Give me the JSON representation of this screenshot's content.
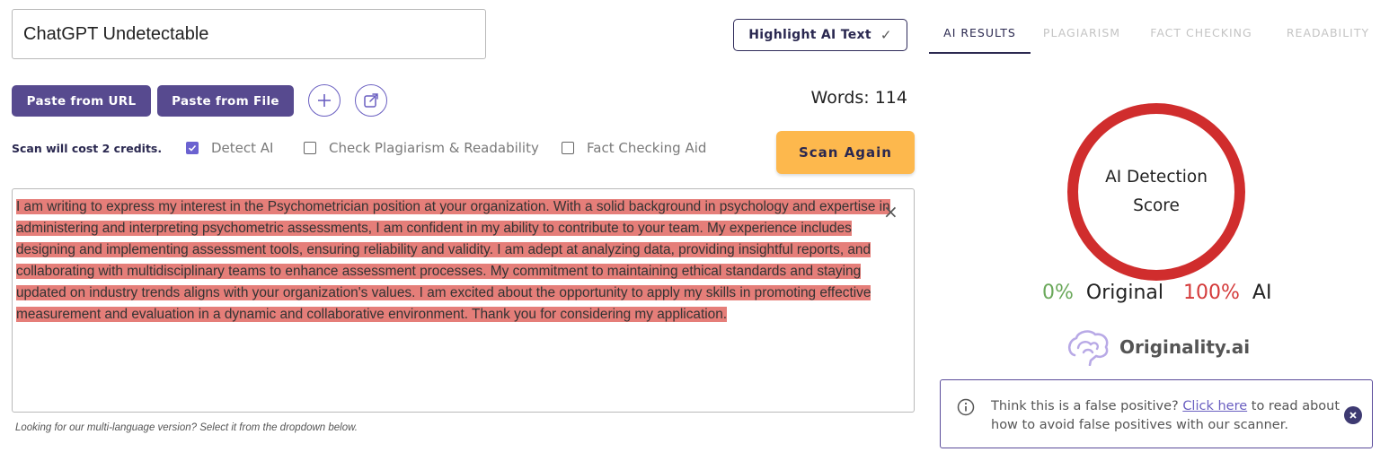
{
  "title_input": {
    "value": "ChatGPT Undetectable"
  },
  "highlight_button": {
    "label": "Highlight AI Text",
    "check": "✓"
  },
  "tabs": [
    {
      "label": "AI RESULTS",
      "active": true
    },
    {
      "label": "PLAGIARISM",
      "active": false
    },
    {
      "label": "FACT CHECKING",
      "active": false
    },
    {
      "label": "READABILITY",
      "active": false
    }
  ],
  "toolbar": {
    "paste_url": "Paste from URL",
    "paste_file": "Paste from File",
    "add_icon": "plus-icon",
    "share_icon": "share-icon",
    "words_label": "Words: 114"
  },
  "scan_options": {
    "cost": "Scan will cost 2 credits.",
    "detect_ai": {
      "label": "Detect AI",
      "checked": true
    },
    "plagiarism": {
      "label": "Check Plagiarism & Readability",
      "checked": false
    },
    "fact_check": {
      "label": "Fact Checking Aid",
      "checked": false
    },
    "scan_button": "Scan Again"
  },
  "editor": {
    "text": "I am writing to express my interest in the Psychometrician position at your organization. With a solid background in psychology and expertise in administering and interpreting psychometric assessments, I am confident in my ability to contribute to your team. My experience includes designing and implementing assessment tools, ensuring reliability and validity. I am adept at analyzing data, providing insightful reports, and collaborating with multidisciplinary teams to enhance assessment processes. My commitment to maintaining ethical standards and staying updated on industry trends aligns with your organization's values. I am excited about the opportunity to apply my skills in promoting effective measurement and evaluation in a dynamic and collaborative environment. Thank you for considering my application.",
    "clear": "×",
    "highlight_color": "#e57e79"
  },
  "footnote": "Looking for our multi-language version? Select it from the dropdown below.",
  "results": {
    "score_label_1": "AI Detection",
    "score_label_2": "Score",
    "original_pct": "0%",
    "original_word": "Original",
    "ai_pct": "100%",
    "ai_word": "AI",
    "ring_color": "#d02d2d",
    "brand": "Originality.ai"
  },
  "notice": {
    "prefix": "Think this is a false positive? ",
    "link": "Click here",
    "suffix": " to read about how to avoid false positives with our scanner."
  },
  "colors": {
    "accent_purple": "#574a8f",
    "scan_orange": "#fdb84d",
    "original_green": "#6aa85a",
    "ai_red": "#d43a3a"
  }
}
